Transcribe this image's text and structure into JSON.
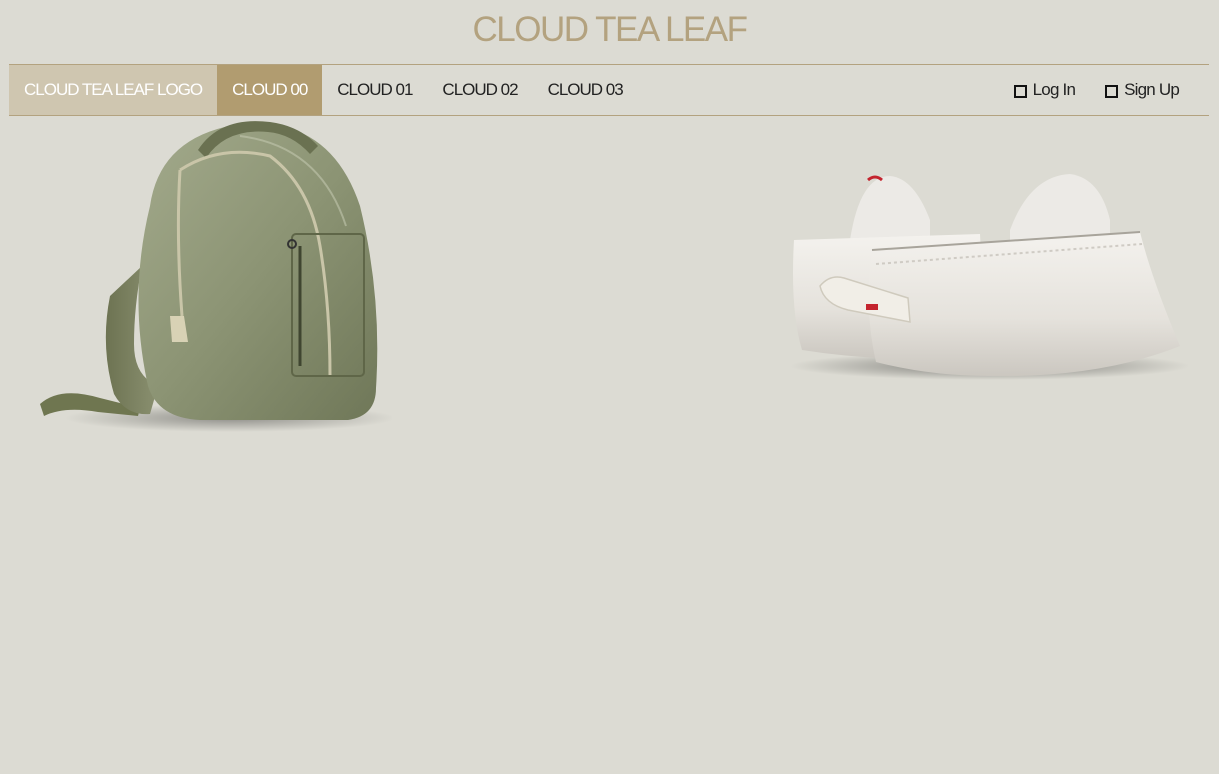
{
  "site": {
    "title": "CLOUD TEA LEAF",
    "title_color": "#b3a27f"
  },
  "nav": {
    "logo_label": "CLOUD TEA LEAF LOGO",
    "logo_bg": "#cfc6b0",
    "active_bg": "#b19c70",
    "items": [
      {
        "label": "CLOUD 00",
        "active": true
      },
      {
        "label": "CLOUD 01",
        "active": false
      },
      {
        "label": "CLOUD 02",
        "active": false
      },
      {
        "label": "CLOUD 03",
        "active": false
      }
    ],
    "login_label": "Log In",
    "signup_label": "Sign Up",
    "divider_color": "#b3a27f"
  },
  "page": {
    "background": "#dcdbd3"
  }
}
